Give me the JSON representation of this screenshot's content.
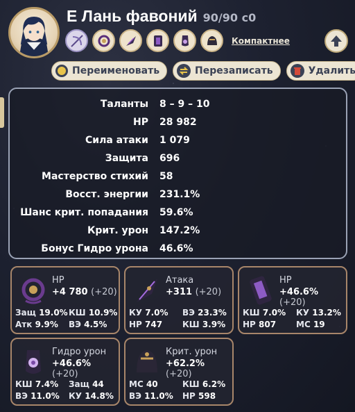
{
  "character": {
    "name": "Е Лань фавоний",
    "level": "90/90 c0"
  },
  "compact_label": "Компактнее",
  "actions": {
    "rename": "Переименовать",
    "rewrite": "Перезаписать",
    "delete": "Удалить"
  },
  "stats": [
    {
      "label": "Таланты",
      "value": "8 – 9 – 10"
    },
    {
      "label": "HP",
      "value": "28 982"
    },
    {
      "label": "Сила атаки",
      "value": "1 079"
    },
    {
      "label": "Защита",
      "value": "696"
    },
    {
      "label": "Мастерство стихий",
      "value": "58"
    },
    {
      "label": "Восст. энергии",
      "value": "231.1%"
    },
    {
      "label": "Шанс крит. попадания",
      "value": "59.6%"
    },
    {
      "label": "Крит. урон",
      "value": "147.2%"
    },
    {
      "label": "Бонус Гидро урона",
      "value": "46.6%"
    }
  ],
  "artifacts": [
    {
      "main": "HP",
      "value": "+4 780",
      "roll": "(+20)",
      "icon": "flower-icon",
      "subs": [
        [
          "Защ",
          "19.0%"
        ],
        [
          "КШ",
          "10.9%"
        ],
        [
          "Атк",
          "9.9%"
        ],
        [
          "ВЭ",
          "4.5%"
        ]
      ]
    },
    {
      "main": "Атака",
      "value": "+311",
      "roll": "(+20)",
      "icon": "plume-icon",
      "subs": [
        [
          "КУ",
          "7.0%"
        ],
        [
          "ВЭ",
          "23.3%"
        ],
        [
          "HP",
          "747"
        ],
        [
          "КШ",
          "3.9%"
        ]
      ]
    },
    {
      "main": "HP",
      "value": "+46.6%",
      "roll": "(+20)",
      "icon": "sands-icon",
      "subs": [
        [
          "КШ",
          "7.0%"
        ],
        [
          "КУ",
          "13.2%"
        ],
        [
          "HP",
          "807"
        ],
        [
          "МС",
          "19"
        ]
      ]
    },
    {
      "main": "Гидро урон",
      "value": "+46.6%",
      "roll": "(+20)",
      "icon": "goblet-icon",
      "subs": [
        [
          "КШ",
          "7.4%"
        ],
        [
          "Защ",
          "44"
        ],
        [
          "ВЭ",
          "11.0%"
        ],
        [
          "КУ",
          "14.8%"
        ]
      ]
    },
    {
      "main": "Крит. урон",
      "value": "+62.2%",
      "roll": "(+20)",
      "icon": "circlet-icon",
      "subs": [
        [
          "МС",
          "40"
        ],
        [
          "КШ",
          "6.2%"
        ],
        [
          "ВЭ",
          "11.0%"
        ],
        [
          "HP",
          "598"
        ]
      ]
    }
  ],
  "colors": {
    "accent": "#ece5d3",
    "panel_border": "#9aa2b5",
    "artifact_border": "#a8866a",
    "delete_icon": "#c0392b"
  }
}
